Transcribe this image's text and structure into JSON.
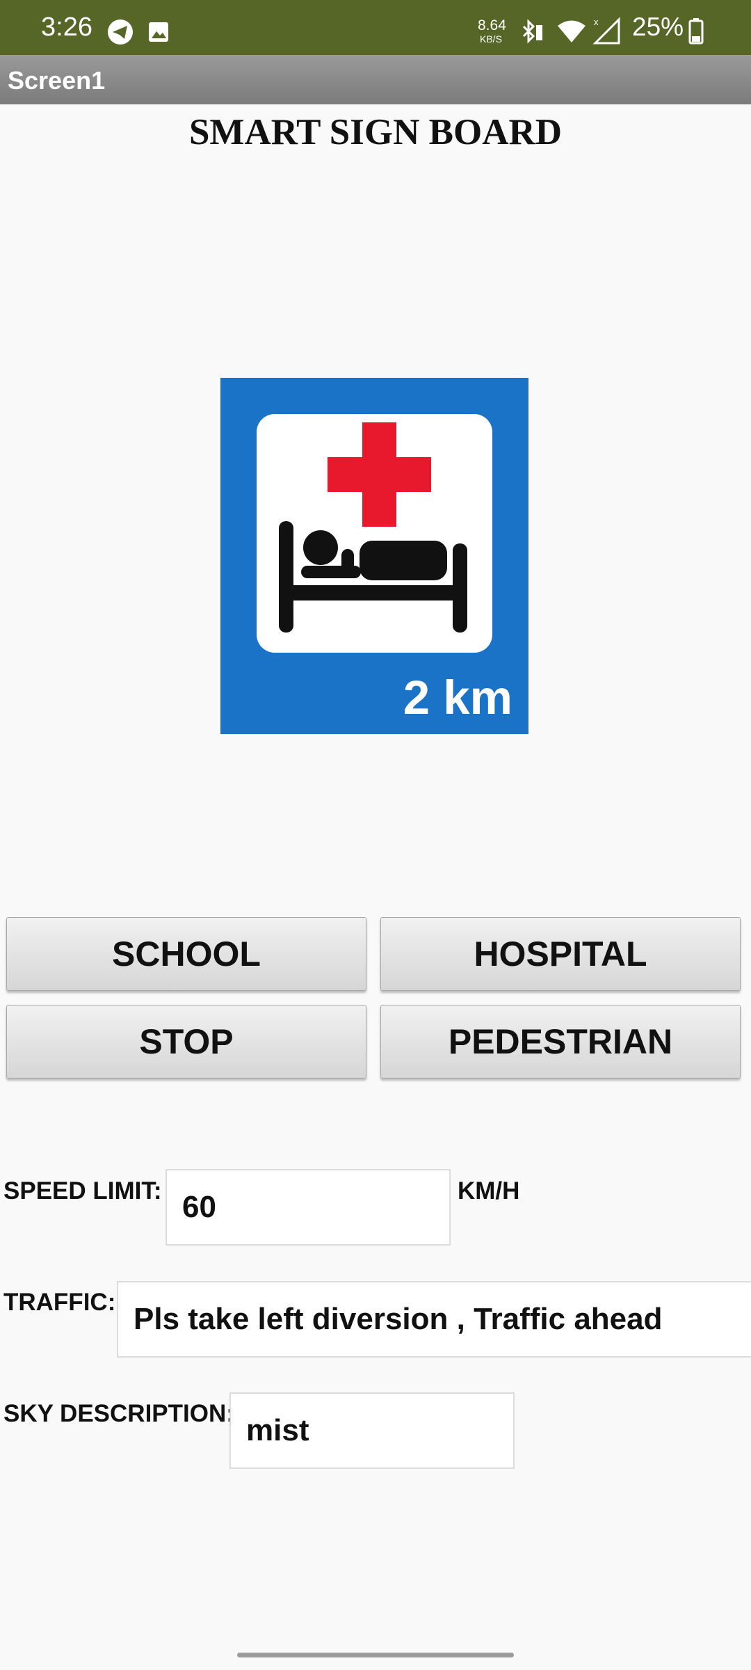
{
  "status_bar": {
    "time": "3:26",
    "net_speed_value": "8.64",
    "net_speed_unit": "KB/S",
    "battery": "25%",
    "icons": [
      "telegram-icon",
      "image-icon",
      "bluetooth-icon",
      "wifi-icon",
      "signal-icon",
      "battery-icon"
    ]
  },
  "title_bar": {
    "title": "Screen1"
  },
  "page": {
    "title": "SMART SIGN BOARD"
  },
  "sign": {
    "distance": "2 km",
    "icon": "hospital-bed-icon",
    "colors": {
      "background": "#1a73c6",
      "cross": "#e8192c"
    }
  },
  "buttons": {
    "school": "SCHOOL",
    "hospital": "HOSPITAL",
    "stop": "STOP",
    "pedestrian": "PEDESTRIAN"
  },
  "form": {
    "speed_limit": {
      "label": "SPEED LIMIT:",
      "value": "60",
      "unit": "KM/H"
    },
    "traffic": {
      "label": "TRAFFIC:",
      "value": "Pls take left diversion , Traffic ahead"
    },
    "sky": {
      "label": "SKY DESCRIPTION:",
      "value": "mist"
    }
  },
  "colors": {
    "status_bar": "#566627"
  }
}
